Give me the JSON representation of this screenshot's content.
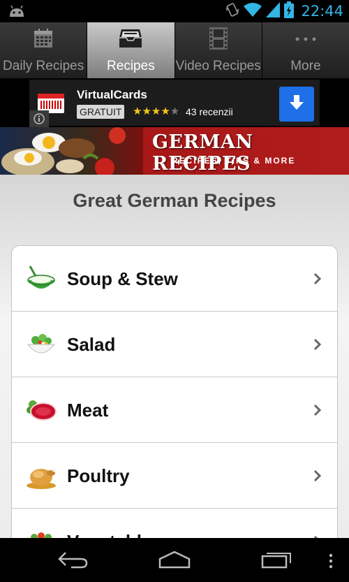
{
  "status_bar": {
    "time": "22:44",
    "icons": [
      "android-icon",
      "vibrate-icon",
      "wifi-icon",
      "signal-icon",
      "battery-charging-icon"
    ],
    "time_color": "#33b5e5"
  },
  "tabs": [
    {
      "label": "Daily Recipes",
      "icon": "calendar-icon",
      "active": false
    },
    {
      "label": "Recipes",
      "icon": "inbox-icon",
      "active": true
    },
    {
      "label": "Video Recipes",
      "icon": "film-icon",
      "active": false
    },
    {
      "label": "More",
      "icon": "more-icon",
      "active": false
    }
  ],
  "ad": {
    "title": "VirtualCards",
    "badge": "GRATUIT",
    "stars_filled": "★★★★",
    "stars_empty": "★",
    "reviews": "43 recenzii",
    "accent": "#1e6fe8"
  },
  "banner": {
    "title": "GERMAN RECIPES",
    "subtitle": "RECIPES, TIPS & MORE"
  },
  "main": {
    "heading": "Great German Recipes",
    "categories": [
      {
        "label": "Soup & Stew",
        "icon": "soup-bowl-icon"
      },
      {
        "label": "Salad",
        "icon": "salad-bowl-icon"
      },
      {
        "label": "Meat",
        "icon": "meat-icon"
      },
      {
        "label": "Poultry",
        "icon": "roast-chicken-icon"
      },
      {
        "label": "Vegetables",
        "icon": "vegetables-icon"
      }
    ]
  },
  "nav_bar": {
    "buttons": [
      "back-icon",
      "home-icon",
      "recent-apps-icon",
      "overflow-menu-icon"
    ]
  }
}
